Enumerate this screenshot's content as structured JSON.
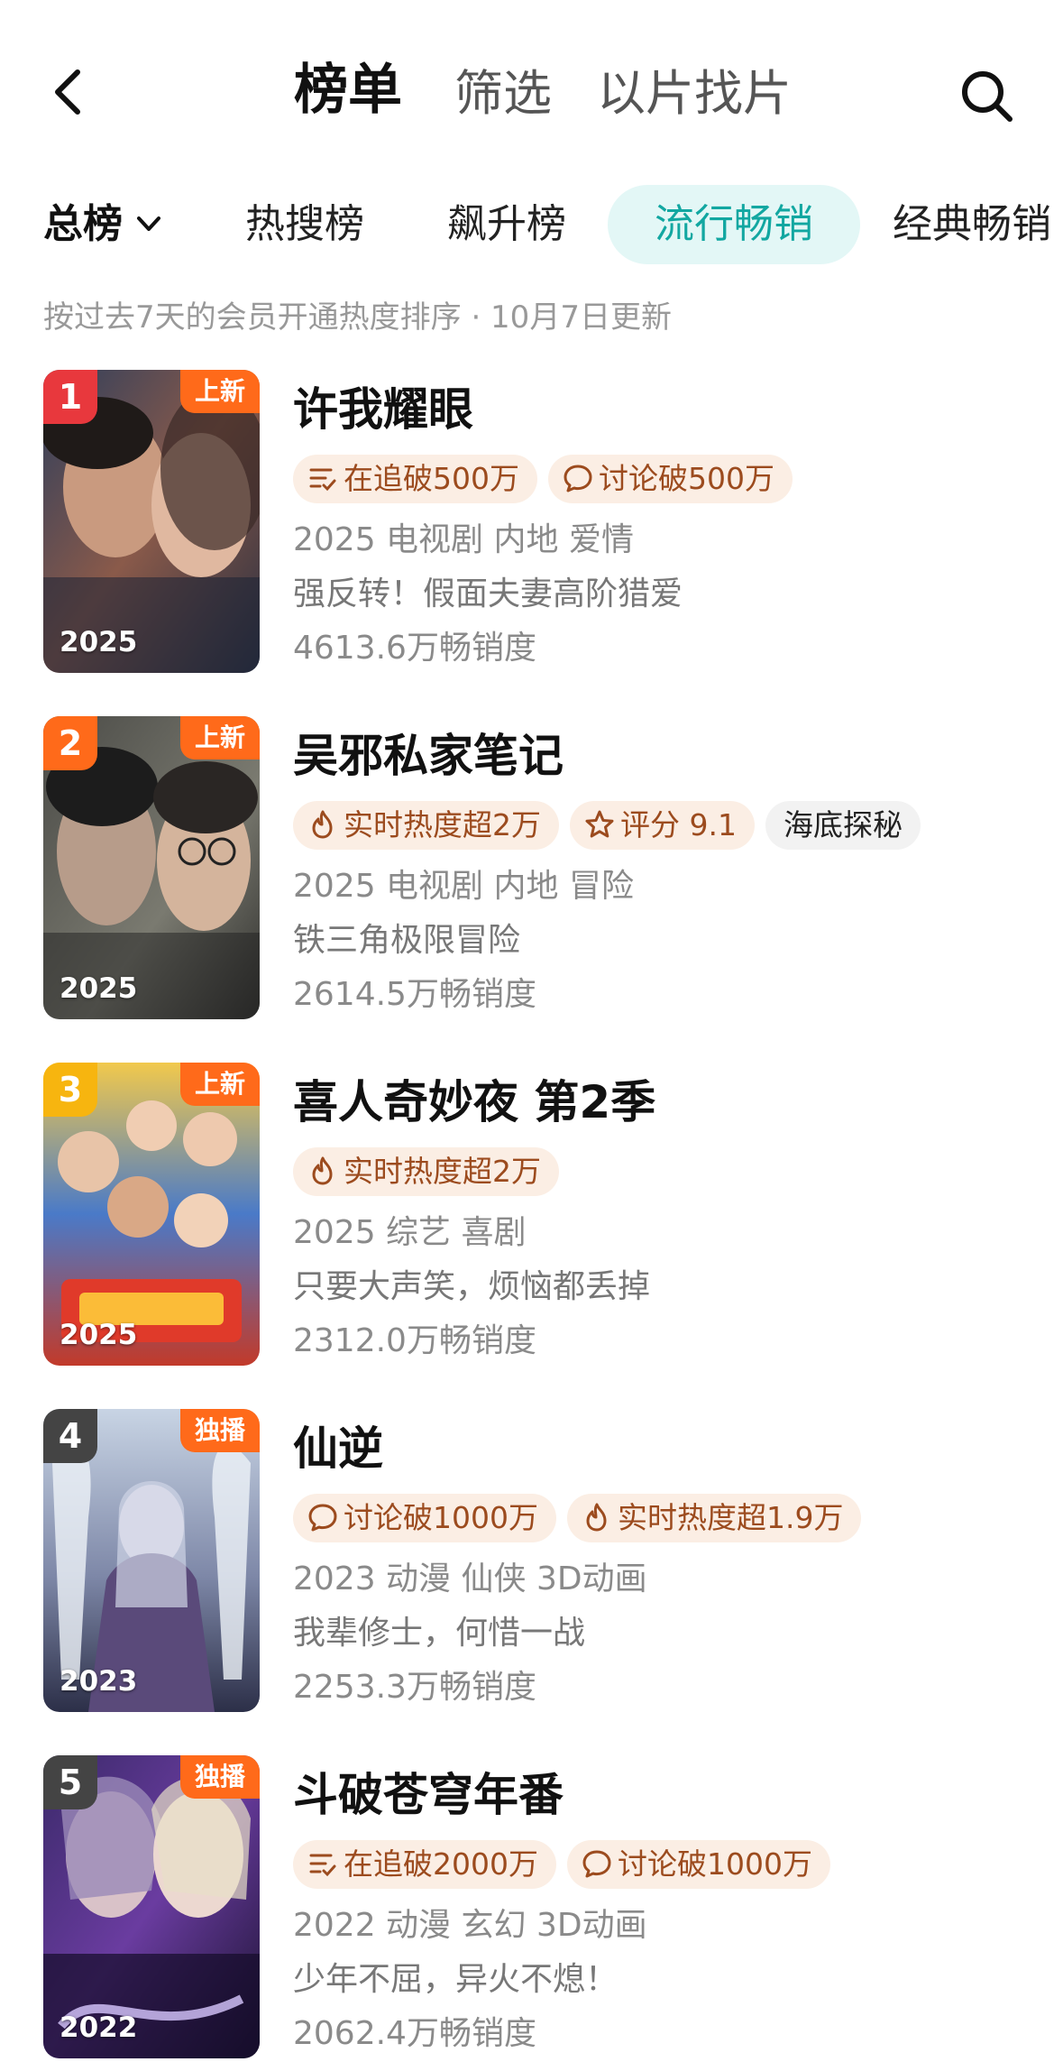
{
  "nav": {
    "tabs": [
      "榜单",
      "筛选",
      "以片找片"
    ]
  },
  "categories": {
    "dropdown_label": "总榜",
    "tabs": [
      "热搜榜",
      "飙升榜",
      "流行畅销",
      "经典畅销"
    ],
    "selected_index": 2
  },
  "subtitle": "按过去7天的会员开通热度排序 · 10月7日更新",
  "items": [
    {
      "rank": "1",
      "badge": "上新",
      "year": "2025",
      "title": "许我耀眼",
      "tags": [
        {
          "icon": "follow-list-icon",
          "text": "在追破500万"
        },
        {
          "icon": "comment-icon",
          "text": "讨论破500万"
        }
      ],
      "genre": "2025 电视剧 内地 爱情",
      "desc": "强反转！假面夫妻高阶猎爱",
      "sales": "4613.6万畅销度"
    },
    {
      "rank": "2",
      "badge": "上新",
      "year": "2025",
      "title": "吴邪私家笔记",
      "tags": [
        {
          "icon": "flame-icon",
          "text": "实时热度超2万"
        },
        {
          "icon": "star-icon",
          "text": "评分 9.1"
        },
        {
          "icon": "",
          "text": "海底探秘"
        }
      ],
      "genre": "2025 电视剧 内地 冒险",
      "desc": "铁三角极限冒险",
      "sales": "2614.5万畅销度"
    },
    {
      "rank": "3",
      "badge": "上新",
      "year": "2025",
      "title": "喜人奇妙夜 第2季",
      "tags": [
        {
          "icon": "flame-icon",
          "text": "实时热度超2万"
        }
      ],
      "genre": "2025 综艺 喜剧",
      "desc": "只要大声笑，烦恼都丢掉",
      "sales": "2312.0万畅销度"
    },
    {
      "rank": "4",
      "badge": "独播",
      "year": "2023",
      "title": "仙逆",
      "tags": [
        {
          "icon": "comment-icon",
          "text": "讨论破1000万"
        },
        {
          "icon": "flame-icon",
          "text": "实时热度超1.9万"
        }
      ],
      "genre": "2023 动漫 仙侠 3D动画",
      "desc": "我辈修士，何惜一战",
      "sales": "2253.3万畅销度"
    },
    {
      "rank": "5",
      "badge": "独播",
      "year": "2022",
      "title": "斗破苍穹年番",
      "tags": [
        {
          "icon": "follow-list-icon",
          "text": "在追破2000万"
        },
        {
          "icon": "comment-icon",
          "text": "讨论破1000万"
        }
      ],
      "genre": "2022 动漫 玄幻 3D动画",
      "desc": "少年不屈，异火不熄！",
      "sales": "2062.4万畅销度"
    }
  ],
  "colors": {
    "accent": "#12a7a1",
    "accent_bg": "#e3f7f6",
    "tag_bg": "#fbeee4",
    "tag_text": "#9c4b1e",
    "badge": "#ff6a1a",
    "rank1": "#e8383d",
    "rank2": "#ff6a1a",
    "rank3": "#f7b50f",
    "rank_other": "#444444"
  }
}
